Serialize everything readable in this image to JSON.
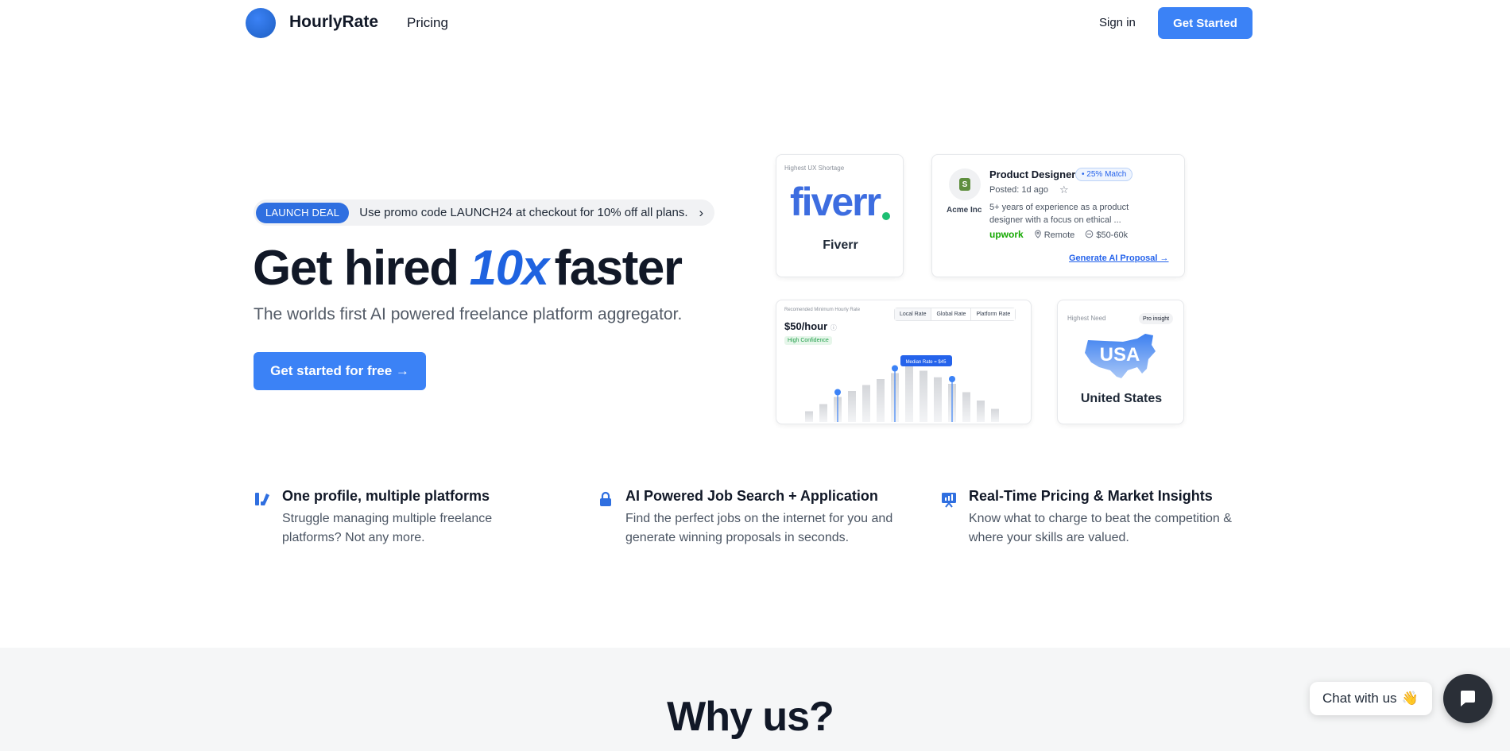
{
  "nav": {
    "brand": "HourlyRate",
    "pricing": "Pricing",
    "sign_in": "Sign in",
    "get_started": "Get Started"
  },
  "promo": {
    "badge": "LAUNCH DEAL",
    "text": "Use promo code LAUNCH24 at checkout for 10% off all plans.",
    "chevron": "›"
  },
  "hero": {
    "title_part1": "Get hired",
    "title_accent": "10x",
    "title_part2": "faster",
    "subtitle": "The worlds first AI powered freelance platform aggregator.",
    "cta": "Get started for free →"
  },
  "cards": {
    "fiverr": {
      "label": "Highest UX Shortage",
      "logo_text": "fiverr",
      "name": "Fiverr"
    },
    "job": {
      "company": "Acme Inc",
      "title": "Product Designer",
      "match": "• 25% Match",
      "posted": "Posted: 1d ago",
      "description": "5+ years of experience as a product designer with a focus on ethical ...",
      "platform": "upwork",
      "location": "Remote",
      "salary": "$50-60k",
      "link": "Generate AI Proposal →"
    },
    "rate": {
      "label": "Recomended Minimum Hourly Rate",
      "value": "$50/hour",
      "confidence": "High Confidence",
      "tabs": [
        "Local Rate",
        "Global Rate",
        "Platform Rate"
      ],
      "tooltip": "Median Rate = $45",
      "bars": [
        0.18,
        0.3,
        0.42,
        0.52,
        0.62,
        0.72,
        0.82,
        0.97,
        0.86,
        0.75,
        0.64,
        0.5,
        0.36,
        0.22
      ]
    },
    "usa": {
      "label": "Highest Need",
      "badge": "Pro insight",
      "map_text": "USA",
      "name": "United States"
    }
  },
  "features": [
    {
      "icon": "platforms-icon",
      "title": "One profile, multiple platforms",
      "description": "Struggle managing multiple freelance platforms? Not any more."
    },
    {
      "icon": "lock-icon",
      "title": "AI Powered Job Search + Application",
      "description": "Find the perfect jobs on the internet for you and generate winning proposals in seconds."
    },
    {
      "icon": "chart-presentation-icon",
      "title": "Real-Time Pricing & Market Insights",
      "description": "Know what to charge to beat the competition & where your skills are valued."
    }
  ],
  "why_us": {
    "title": "Why us?"
  },
  "chat": {
    "label": "Chat with us",
    "wave": "👋"
  },
  "colors": {
    "primary": "#3b82f6",
    "accent_text": "#1f63e0",
    "upwork_green": "#14a800",
    "fiverr_green": "#1dbf73"
  }
}
